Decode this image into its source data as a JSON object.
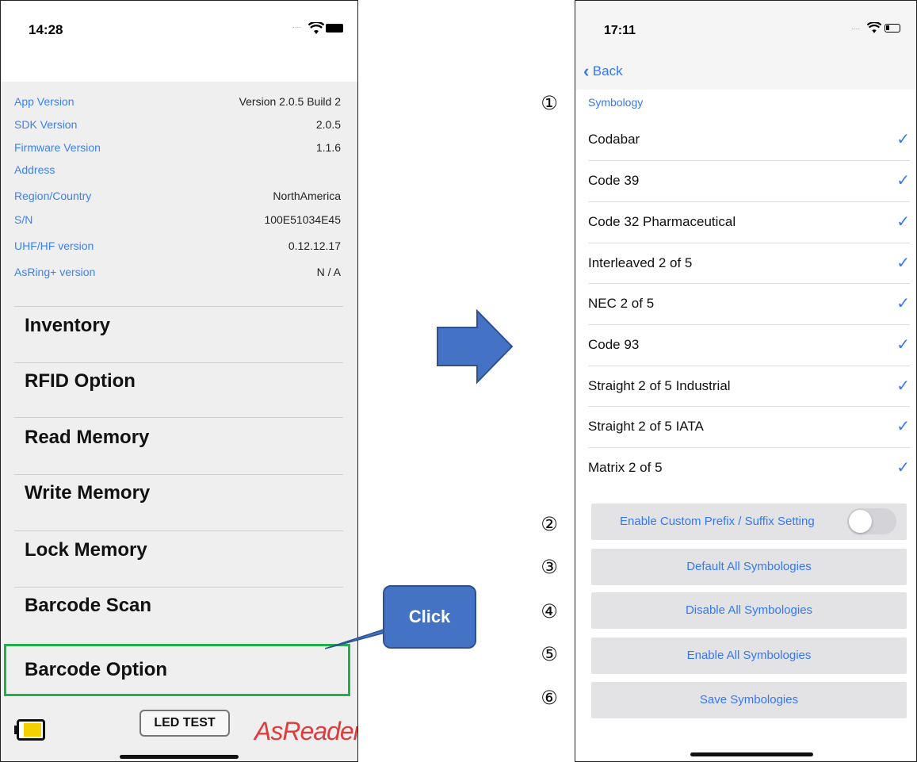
{
  "left": {
    "time": "14:28",
    "info": [
      {
        "label": "App Version",
        "value": "Version 2.0.5 Build 2"
      },
      {
        "label": "SDK Version",
        "value": "2.0.5"
      },
      {
        "label": "Firmware Version",
        "value": "1.1.6"
      },
      {
        "label": "Address",
        "value": ""
      },
      {
        "label": "Region/Country",
        "value": "NorthAmerica"
      },
      {
        "label": "S/N",
        "value": "100E51034E45"
      },
      {
        "label": "UHF/HF version",
        "value": "0.12.12.17"
      },
      {
        "label": "AsRing+ version",
        "value": "N / A"
      }
    ],
    "menu": [
      "Inventory",
      "RFID Option",
      "Read Memory",
      "Write Memory",
      "Lock Memory",
      "Barcode Scan",
      "Barcode Option"
    ],
    "led_test": "LED TEST",
    "logo": "AsReader",
    "highlight_color": "#22b04b"
  },
  "callout": {
    "label": "Click",
    "color": "#4472c4"
  },
  "arrow_color": "#4472c4",
  "right": {
    "time": "17:11",
    "back_label": "Back",
    "section_header": "Symbology",
    "symbologies": [
      {
        "name": "Codabar",
        "checked": true
      },
      {
        "name": "Code 39",
        "checked": true
      },
      {
        "name": "Code 32 Pharmaceutical",
        "checked": true
      },
      {
        "name": "Interleaved 2 of 5",
        "checked": true
      },
      {
        "name": "NEC 2 of 5",
        "checked": true
      },
      {
        "name": "Code 93",
        "checked": true
      },
      {
        "name": "Straight 2 of 5 Industrial",
        "checked": true
      },
      {
        "name": "Straight 2 of 5 IATA",
        "checked": true
      },
      {
        "name": "Matrix 2 of 5",
        "checked": true
      }
    ],
    "custom_toggle_label": "Enable Custom Prefix / Suffix Setting",
    "custom_toggle_on": false,
    "buttons": [
      "Default All Symbologies",
      "Disable All Symbologies",
      "Enable All Symbologies",
      "Save Symbologies"
    ],
    "accent_color": "#3478f6"
  },
  "markers": [
    "①",
    "②",
    "③",
    "④",
    "⑤",
    "⑥"
  ]
}
